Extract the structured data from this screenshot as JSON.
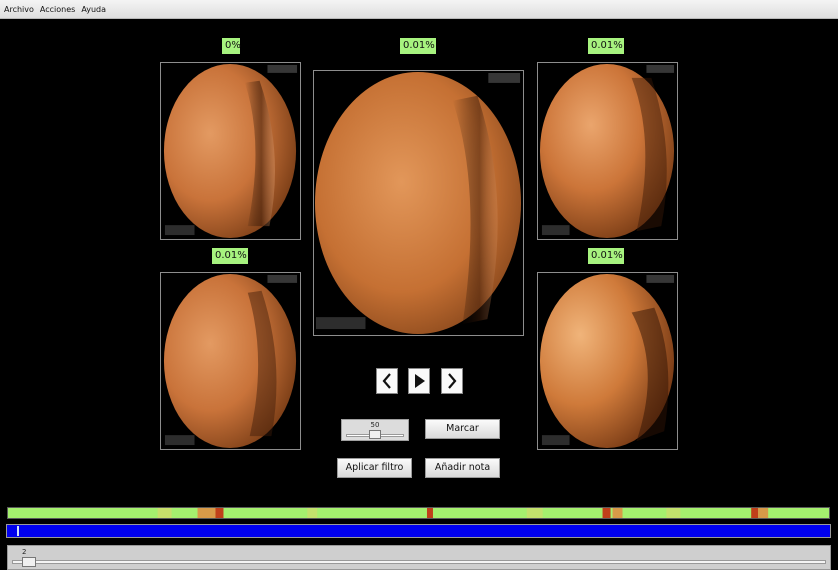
{
  "menu": {
    "items": [
      "Archivo",
      "Acciones",
      "Ayuda"
    ]
  },
  "frames": {
    "top_left": {
      "percent": "0%"
    },
    "center": {
      "percent": "0.01%"
    },
    "top_right": {
      "percent": "0.01%"
    },
    "bottom_left": {
      "percent": "0.01%"
    },
    "bottom_right": {
      "percent": "0.01%"
    }
  },
  "playback": {
    "prev_icon": "chevron-left-icon",
    "play_icon": "play-icon",
    "next_icon": "chevron-right-icon"
  },
  "speed_slider": {
    "value": "50",
    "min": 0,
    "max": 100,
    "level": 50
  },
  "buttons": {
    "mark": "Marcar",
    "apply_filter": "Aplicar filtro",
    "add_note": "Añadir nota"
  },
  "progress": {
    "position_fraction": 0.01
  },
  "frame_slider": {
    "value": "2",
    "fraction": 0.01
  },
  "colors": {
    "label_bg": "#a7f37f",
    "progress_bar": "#0000ee",
    "heat_low": "#a5f06e",
    "heat_high": "#c0401a"
  }
}
